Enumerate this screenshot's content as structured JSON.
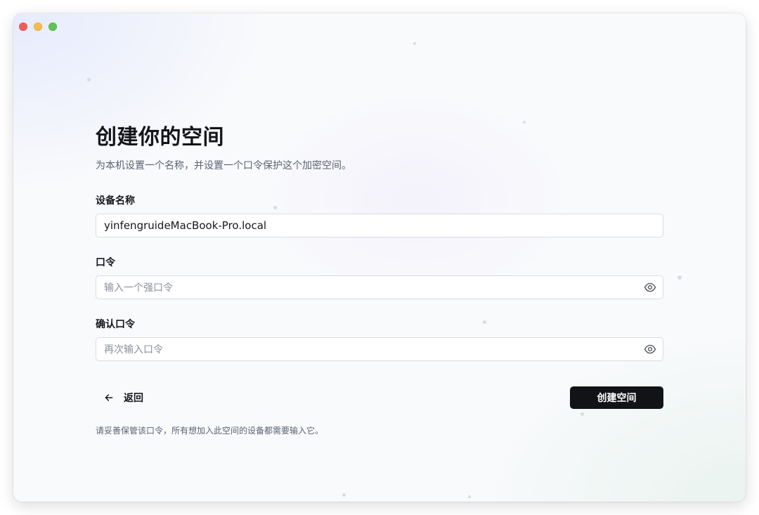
{
  "window": {
    "controls": [
      "close",
      "minimize",
      "maximize"
    ]
  },
  "page": {
    "title": "创建你的空间",
    "subtitle": "为本机设置一个名称，并设置一个口令保护这个加密空间。"
  },
  "form": {
    "device_name": {
      "label": "设备名称",
      "value": "yinfengruideMacBook-Pro.local",
      "placeholder": ""
    },
    "passphrase": {
      "label": "口令",
      "value": "",
      "placeholder": "输入一个强口令",
      "icon": "eye-icon"
    },
    "confirm_passphrase": {
      "label": "确认口令",
      "value": "",
      "placeholder": "再次输入口令",
      "icon": "eye-icon"
    }
  },
  "actions": {
    "back_label": "返回",
    "back_icon": "arrow-left-icon",
    "create_label": "创建空间"
  },
  "footer": {
    "note": "请妥善保管该口令，所有想加入此空间的设备都需要输入它。"
  },
  "colors": {
    "primary_button": "#121316",
    "primary_button_text": "#ffffff",
    "close": "#ee5f57",
    "minimize": "#f4bd4f",
    "maximize": "#5fc454"
  }
}
